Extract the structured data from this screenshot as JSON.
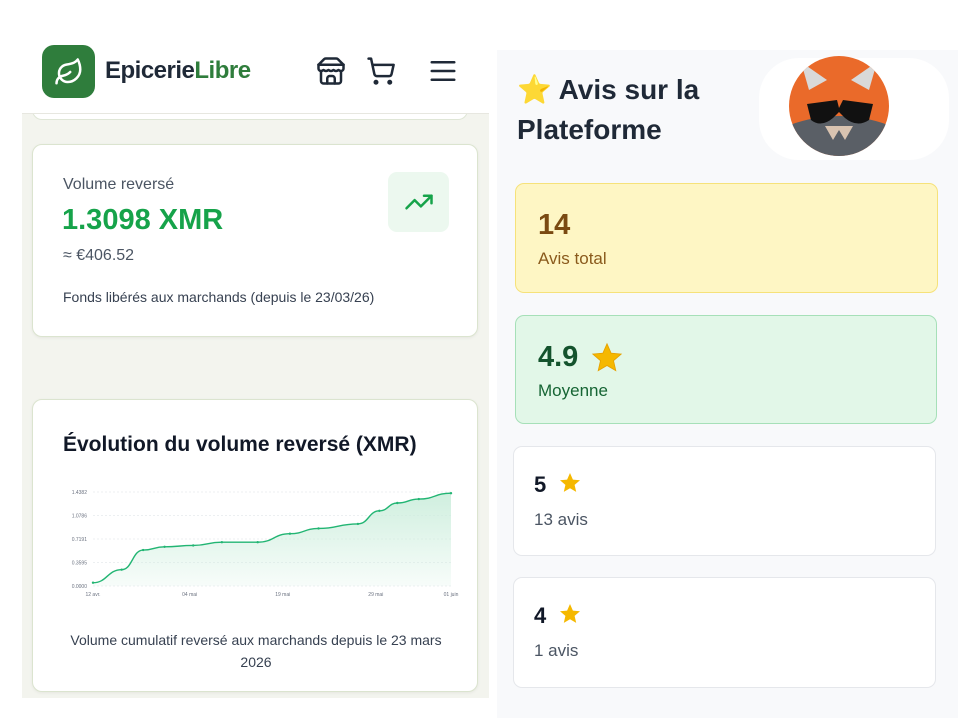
{
  "header": {
    "brand_part1": "Epicerie",
    "brand_part2": "Libre",
    "icons": [
      "leaf-icon",
      "store-icon",
      "cart-icon",
      "menu-icon"
    ]
  },
  "volume_card": {
    "label": "Volume reversé",
    "value": "1.3098 XMR",
    "eur": "≈ €406.52",
    "note": "Fonds libérés aux marchands (depuis le 23/03/26)",
    "icon": "trending-up-icon"
  },
  "chart_card": {
    "title": "Évolution du volume reversé (XMR)",
    "note": "Volume cumulatif reversé aux marchands depuis le 23 mars 2026"
  },
  "chart_data": {
    "type": "area",
    "title": "",
    "xlabel": "",
    "ylabel": "",
    "y_ticks": [
      "1.4382",
      "1.0786",
      "0.7191",
      "0.3595",
      "0.0000"
    ],
    "x_ticks": [
      "12 avr.",
      "04 mai",
      "19 mai",
      "29 mai",
      "01 juin"
    ],
    "ylim": [
      0,
      1.4382
    ],
    "grid": true,
    "x": [
      0,
      0.08,
      0.14,
      0.2,
      0.28,
      0.36,
      0.46,
      0.55,
      0.63,
      0.74,
      0.8,
      0.85,
      0.91,
      1.0
    ],
    "y": [
      0.05,
      0.25,
      0.55,
      0.6,
      0.62,
      0.67,
      0.67,
      0.8,
      0.88,
      0.95,
      1.15,
      1.27,
      1.33,
      1.42
    ],
    "colors": {
      "line": "#22b573",
      "fill": "#cdeedd"
    }
  },
  "reviews": {
    "title_line1": "Avis sur la",
    "title_line2": "Plateforme",
    "title_star": "⭐",
    "total_value": "14",
    "total_label": "Avis total",
    "avg_value": "4.9",
    "avg_label": "Moyenne",
    "rows": [
      {
        "stars": "5",
        "count": "13 avis"
      },
      {
        "stars": "4",
        "count": "1 avis"
      }
    ]
  },
  "colors": {
    "brand_green": "#2f7d3c",
    "value_green": "#16a34a",
    "yellow_card": "#fef6c4",
    "green_card": "#e2f7e8",
    "star": "#f5b800"
  }
}
